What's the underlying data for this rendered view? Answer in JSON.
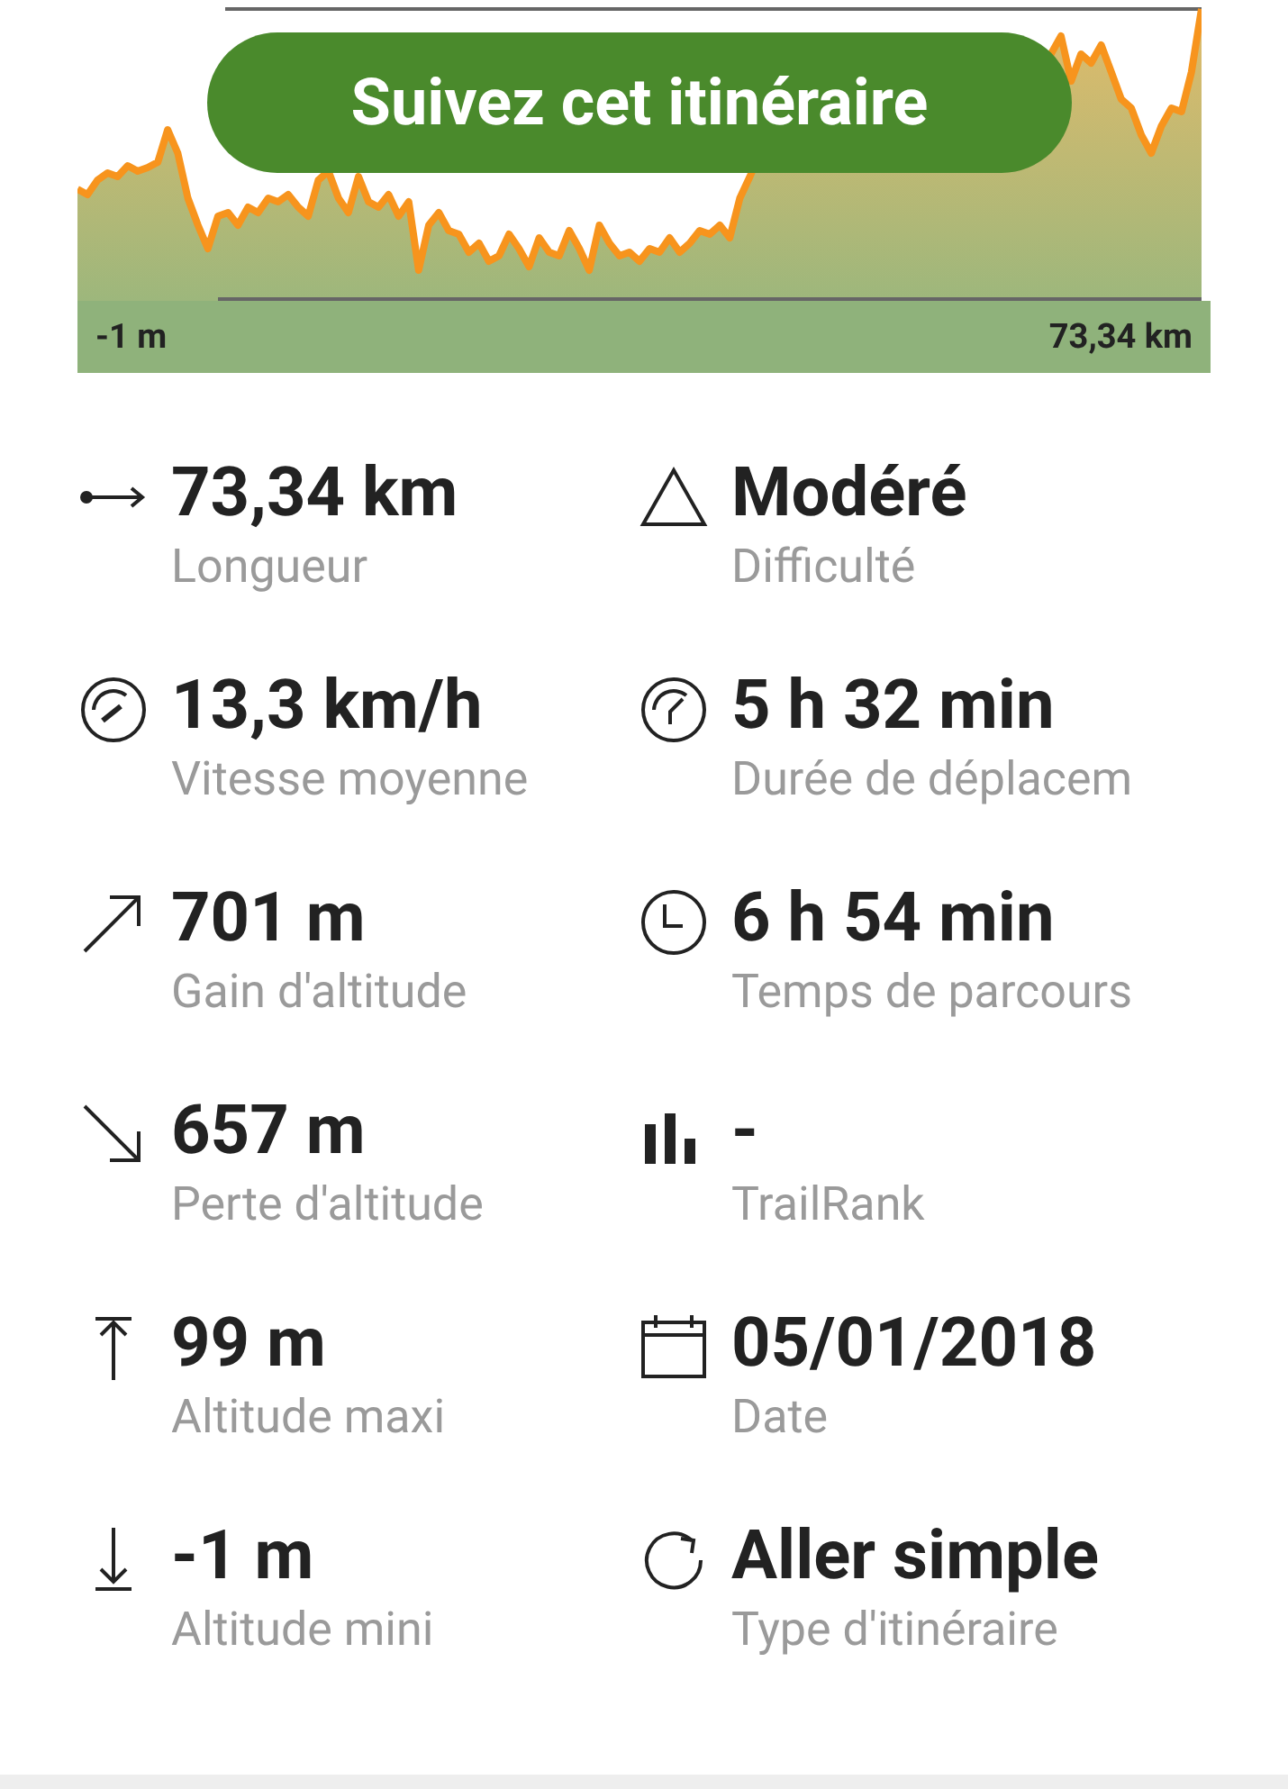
{
  "profile": {
    "min_label": "-1 m",
    "distance_label": "73,34 km",
    "button": "Suivez cet itinéraire"
  },
  "stats": [
    {
      "kind": "length",
      "value": "73,34 km",
      "label": "Longueur"
    },
    {
      "kind": "difficulty",
      "value": "Modéré",
      "label": "Difficulté"
    },
    {
      "kind": "speed",
      "value": "13,3 km/h",
      "label": "Vitesse moyenne"
    },
    {
      "kind": "moving-time",
      "value": "5 h 32 min",
      "label": "Durée de déplacem"
    },
    {
      "kind": "gain",
      "value": "701 m",
      "label": "Gain d'altitude"
    },
    {
      "kind": "total-time",
      "value": "6 h 54 min",
      "label": "Temps de parcours"
    },
    {
      "kind": "loss",
      "value": "657 m",
      "label": "Perte d'altitude"
    },
    {
      "kind": "rank",
      "value": "-",
      "label": "TrailRank"
    },
    {
      "kind": "max",
      "value": "99 m",
      "label": "Altitude maxi"
    },
    {
      "kind": "date",
      "value": "05/01/2018",
      "label": "Date"
    },
    {
      "kind": "min",
      "value": "-1 m",
      "label": "Altitude mini"
    },
    {
      "kind": "route-type",
      "value": "Aller simple",
      "label": "Type d'itinéraire"
    }
  ]
}
